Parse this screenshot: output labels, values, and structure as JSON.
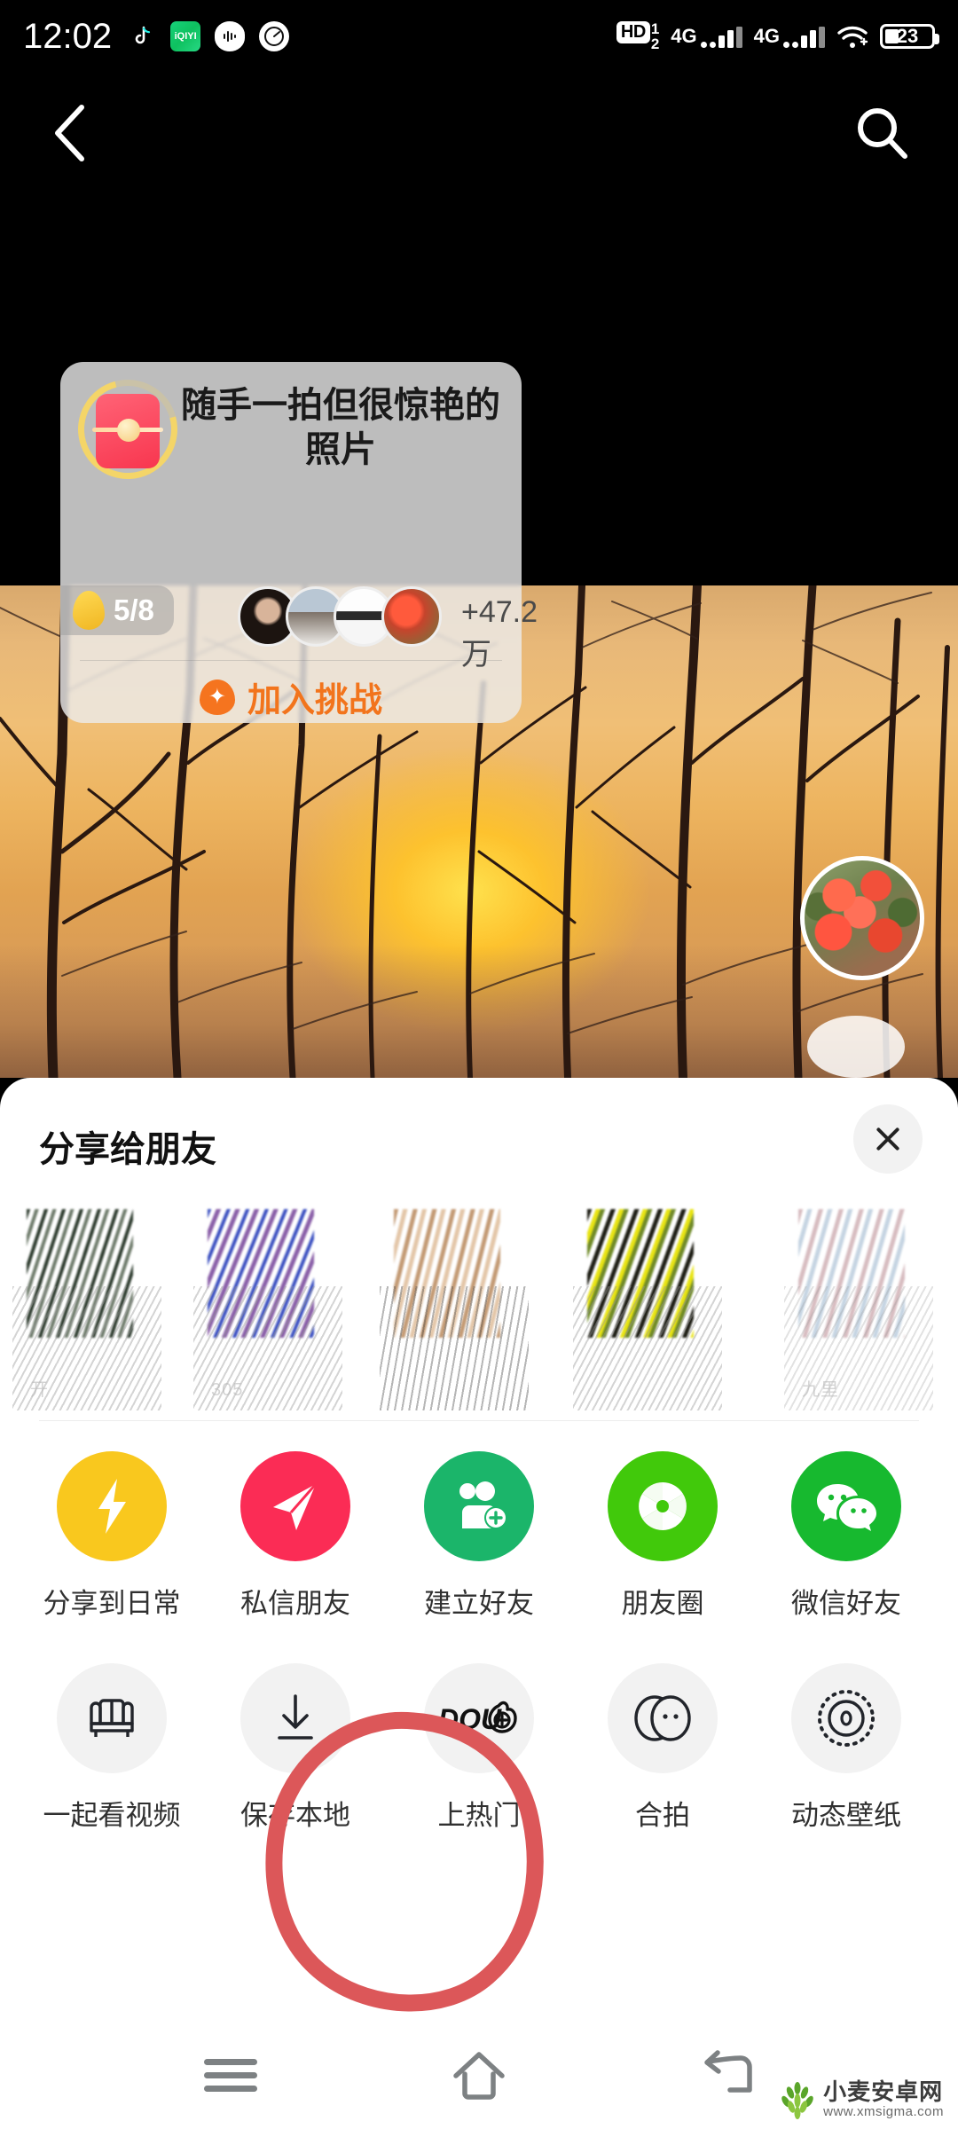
{
  "status_bar": {
    "time": "12:02",
    "app_icons": [
      {
        "name": "douyin-icon",
        "label": "♪"
      },
      {
        "name": "iqiyi-icon",
        "label": "iQIYI"
      },
      {
        "name": "audio-icon",
        "label": "audio"
      },
      {
        "name": "speedometer-icon",
        "label": "speed"
      }
    ],
    "hd_label": "HD",
    "sim1_index": "1",
    "sim2_index": "2",
    "network_1": "4G",
    "network_2": "4G",
    "wifi": "wifi-icon",
    "battery_percent": "23"
  },
  "top_nav": {
    "back_icon": "back-chevron-icon",
    "search_icon": "search-icon"
  },
  "challenge_card": {
    "title": "随手一拍但很惊艳的照片",
    "badge_icon": "red-envelope-badge-icon",
    "egg_icon": "egg-icon",
    "progress": "5/8",
    "participant_count": "+47.2万",
    "join_icon": "sparkle-icon",
    "join_label": "加入挑战"
  },
  "video": {
    "avatar_icon": "flower-avatar-icon"
  },
  "share_sheet": {
    "title": "分享给朋友",
    "close_icon": "close-icon",
    "friends": [
      {
        "name": "friend-avatar-1",
        "caption": "开"
      },
      {
        "name": "friend-avatar-2",
        "caption": "305"
      },
      {
        "name": "friend-avatar-3",
        "caption": ""
      },
      {
        "name": "friend-avatar-4",
        "caption": ""
      },
      {
        "name": "friend-avatar-5",
        "caption": "九里"
      }
    ],
    "row1": [
      {
        "label": "分享到日常",
        "icon": "lightning-icon",
        "color": "#f9c81e",
        "icon_name": "share-to-daily"
      },
      {
        "label": "私信朋友",
        "icon": "paper-plane-icon",
        "color": "#fb2c55",
        "icon_name": "direct-message-friend"
      },
      {
        "label": "建立好友",
        "icon": "add-friend-icon",
        "color": "#1bb56a",
        "icon_name": "create-friend"
      },
      {
        "label": "朋友圈",
        "icon": "camera-shutter-icon",
        "color": "#41c90b",
        "icon_name": "wechat-moments"
      },
      {
        "label": "微信好友",
        "icon": "wechat-icon",
        "color": "#17b92f",
        "icon_name": "wechat-friend"
      }
    ],
    "row2": [
      {
        "label": "一起看视频",
        "icon": "sofa-icon",
        "color": "#f2f2f2",
        "icon_name": "watch-together"
      },
      {
        "label": "保存本地",
        "icon": "download-icon",
        "color": "#f2f2f2",
        "icon_name": "save-local"
      },
      {
        "label": "上热门",
        "icon": "dou-plus-icon",
        "color": "#f2f2f2",
        "icon_name": "promote-dou-plus"
      },
      {
        "label": "合拍",
        "icon": "duet-icon",
        "color": "#f2f2f2",
        "icon_name": "duet"
      },
      {
        "label": "动态壁纸",
        "icon": "live-wallpaper-icon",
        "color": "#f2f2f2",
        "icon_name": "live-wallpaper"
      }
    ],
    "annotation": {
      "name": "red-circle-annotation",
      "color": "#dc5759",
      "target": "上热门"
    }
  },
  "bottom_nav": {
    "items": [
      {
        "name": "recents-button",
        "icon": "hamburger-icon"
      },
      {
        "name": "home-button",
        "icon": "home-icon"
      },
      {
        "name": "back-button",
        "icon": "back-arrow-icon"
      }
    ]
  },
  "watermark": {
    "site_cn": "小麦安卓网",
    "site_url": "www.xmsigma.com"
  }
}
